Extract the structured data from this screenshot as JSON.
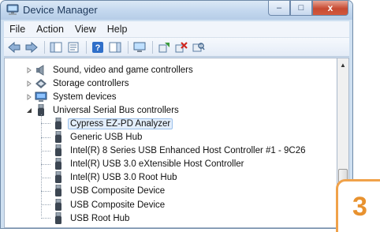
{
  "window": {
    "title": "Device Manager",
    "icon": "computer-icon",
    "controls": {
      "minimize": "–",
      "maximize": "□",
      "close": "x"
    }
  },
  "menu": [
    "File",
    "Action",
    "View",
    "Help"
  ],
  "toolbar": [
    "back-arrow-icon",
    "forward-arrow-icon",
    "console-tree-icon",
    "properties-icon",
    "help-icon",
    "action-pane-icon",
    "monitor-icon",
    "update-driver-icon",
    "disable-device-icon",
    "scan-hardware-icon"
  ],
  "tree": [
    {
      "label": "Sound, video and game controllers",
      "icon": "speaker-icon",
      "expander": "collapsed"
    },
    {
      "label": "Storage controllers",
      "icon": "storage-icon",
      "expander": "collapsed"
    },
    {
      "label": "System devices",
      "icon": "system-icon",
      "expander": "collapsed"
    },
    {
      "label": "Universal Serial Bus controllers",
      "icon": "usb-icon",
      "expander": "expanded"
    },
    {
      "label": "Cypress EZ-PD Analyzer",
      "icon": "usb-icon",
      "selected": true
    },
    {
      "label": "Generic USB Hub",
      "icon": "usb-icon"
    },
    {
      "label": "Intel(R) 8 Series USB Enhanced Host Controller #1 - 9C26",
      "icon": "usb-icon"
    },
    {
      "label": "Intel(R) USB 3.0 eXtensible Host Controller",
      "icon": "usb-icon"
    },
    {
      "label": "Intel(R) USB 3.0 Root Hub",
      "icon": "usb-icon"
    },
    {
      "label": "USB Composite Device",
      "icon": "usb-icon"
    },
    {
      "label": "USB Composite Device",
      "icon": "usb-icon"
    },
    {
      "label": "USB Root Hub",
      "icon": "usb-icon"
    }
  ],
  "step_badge": "3"
}
